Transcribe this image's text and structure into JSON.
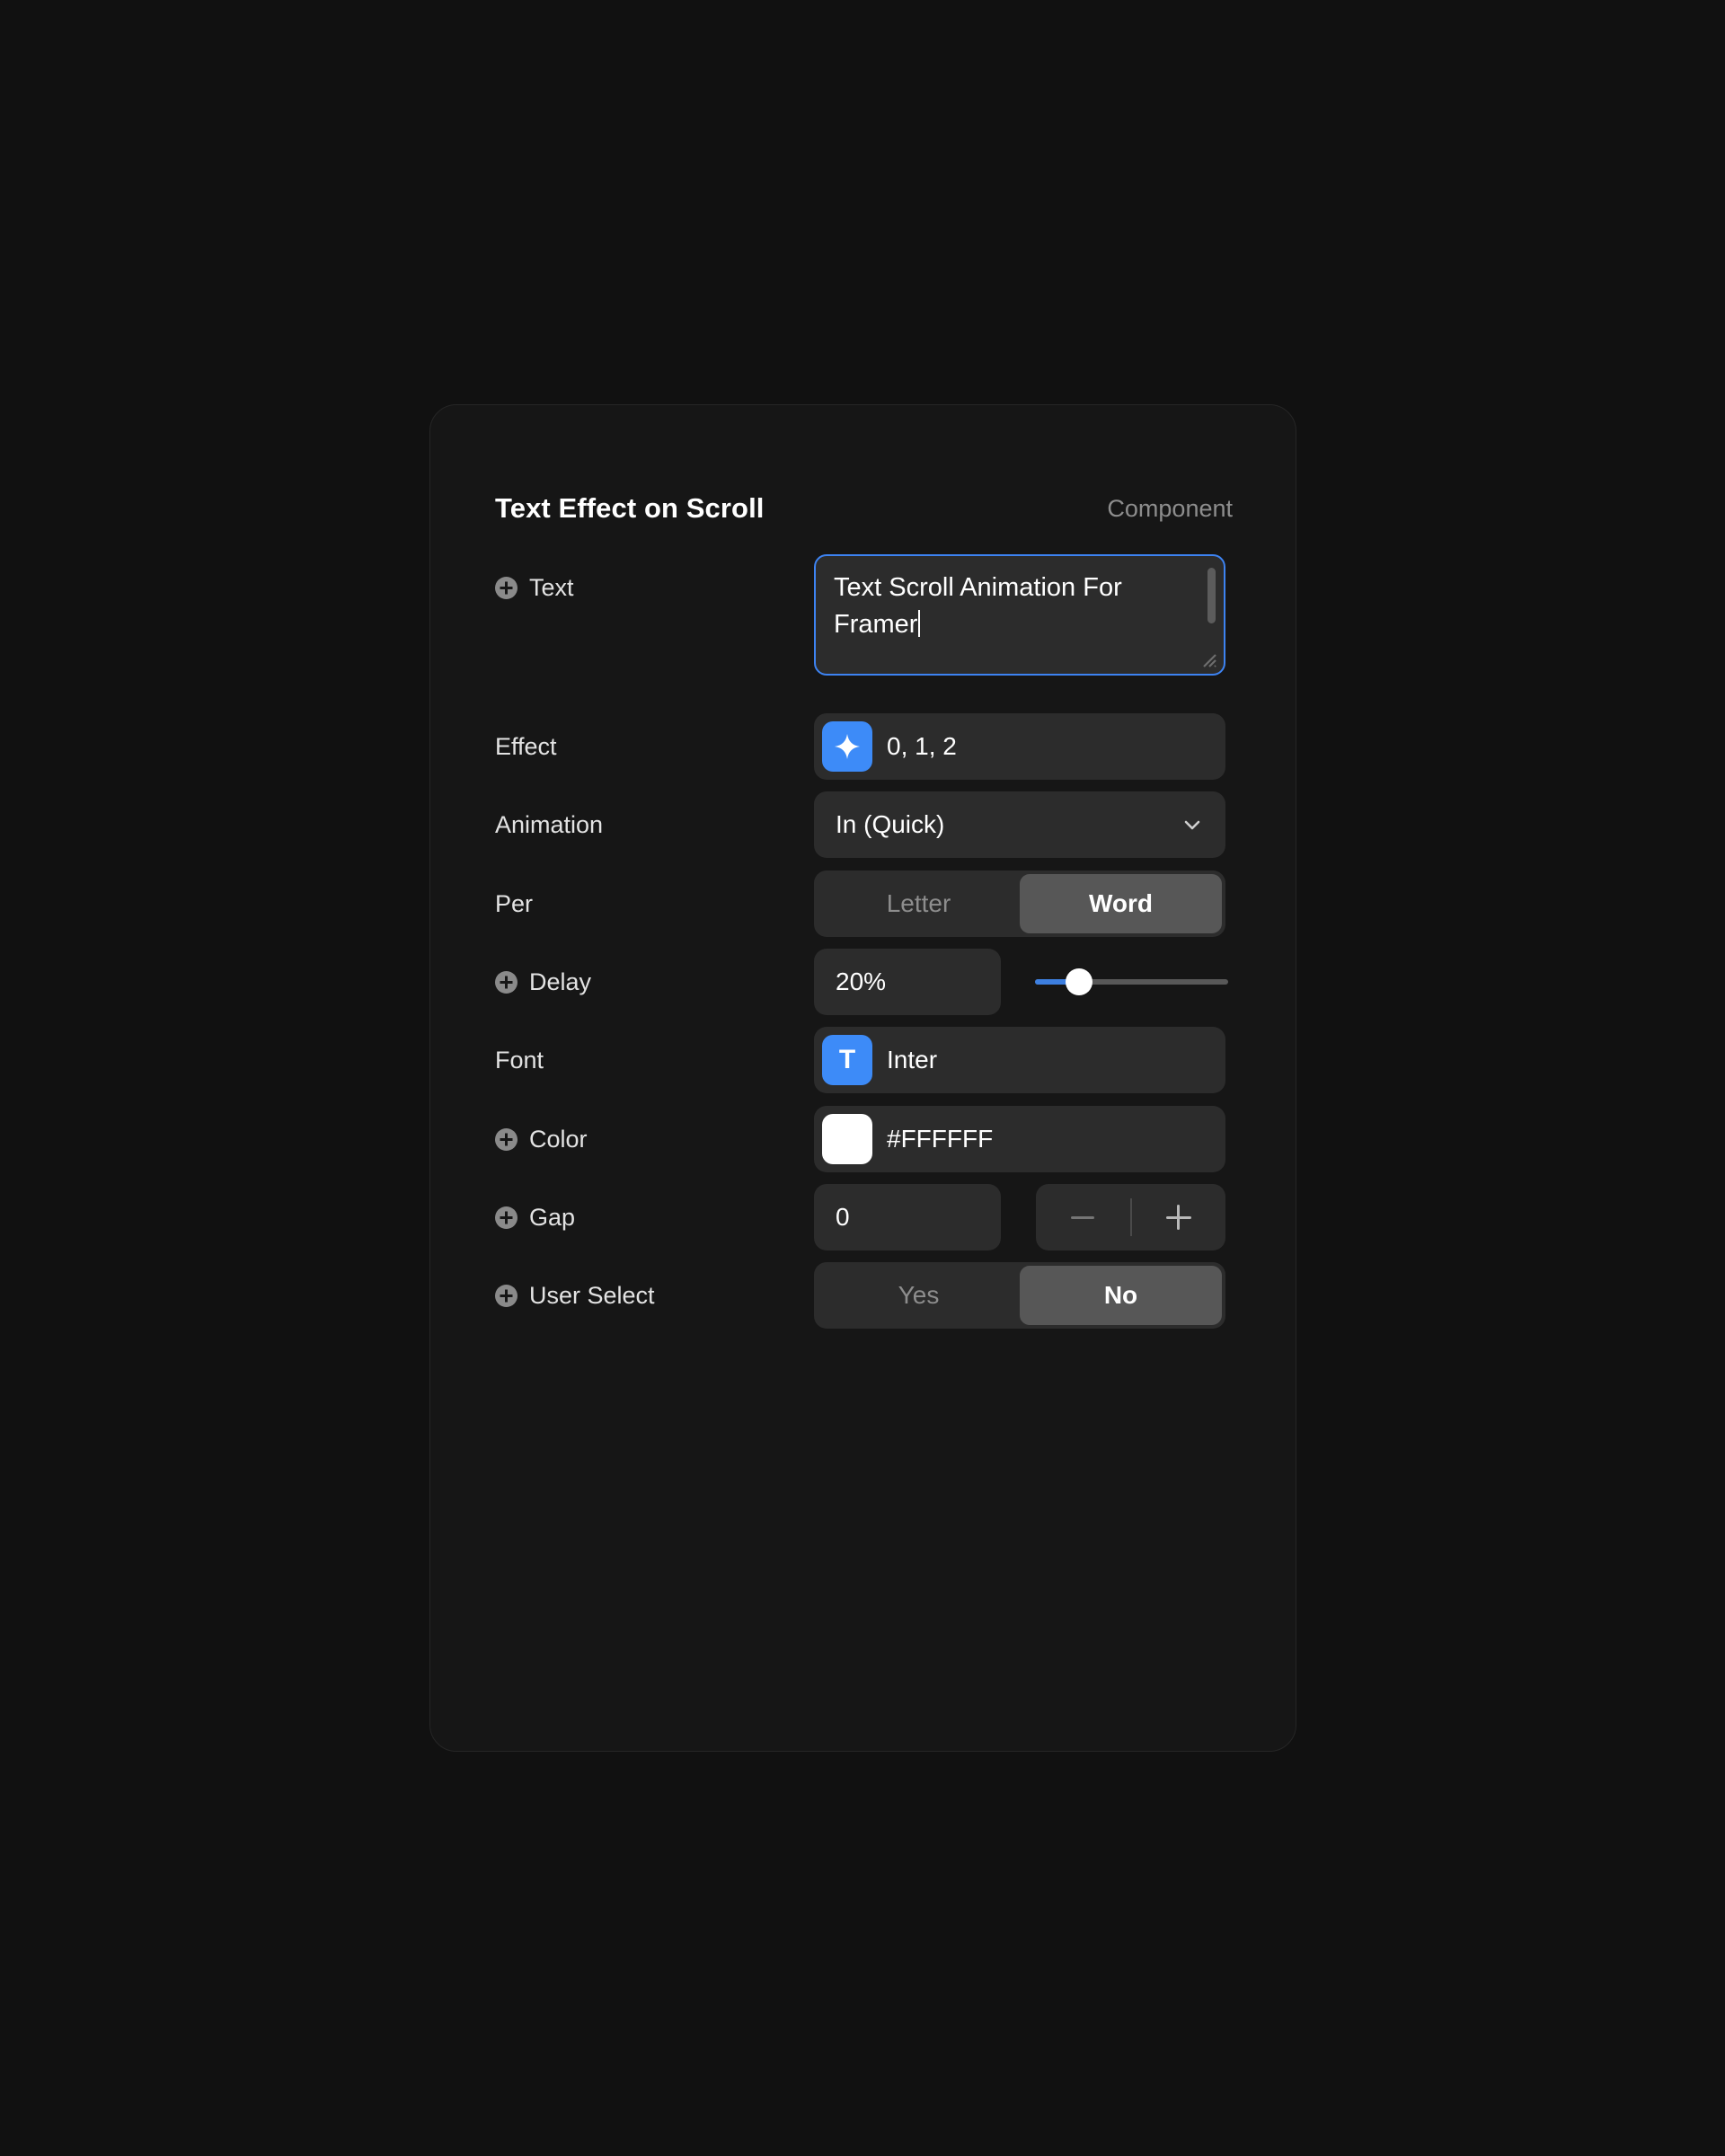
{
  "header": {
    "title": "Text Effect on Scroll",
    "kind": "Component"
  },
  "properties": {
    "text": {
      "label": "Text",
      "has_add_icon": true,
      "value": "Text Scroll Animation For Framer",
      "focused": true,
      "border_color": "#3D83F2"
    },
    "effect": {
      "label": "Effect",
      "has_add_icon": false,
      "icon": "sparkle-icon",
      "icon_bg": "#3D8BF8",
      "value": "0, 1, 2"
    },
    "animation": {
      "label": "Animation",
      "has_add_icon": false,
      "value": "In (Quick)",
      "chevron": "chevron-down-icon"
    },
    "per": {
      "label": "Per",
      "has_add_icon": false,
      "options": [
        "Letter",
        "Word"
      ],
      "selected": "Word"
    },
    "delay": {
      "label": "Delay",
      "has_add_icon": true,
      "value": "20%",
      "slider_percent": 23,
      "slider_fill_color": "#3D7FE0"
    },
    "font": {
      "label": "Font",
      "has_add_icon": false,
      "icon": "text-type-icon",
      "icon_glyph": "T",
      "icon_bg": "#3D8BF8",
      "value": "Inter"
    },
    "color": {
      "label": "Color",
      "has_add_icon": true,
      "swatch": "#FFFFFF",
      "value": "#FFFFFF"
    },
    "gap": {
      "label": "Gap",
      "has_add_icon": true,
      "value": "0",
      "decrement_label": "−",
      "increment_label": "+"
    },
    "user_select": {
      "label": "User Select",
      "has_add_icon": true,
      "options": [
        "Yes",
        "No"
      ],
      "selected": "No"
    }
  }
}
